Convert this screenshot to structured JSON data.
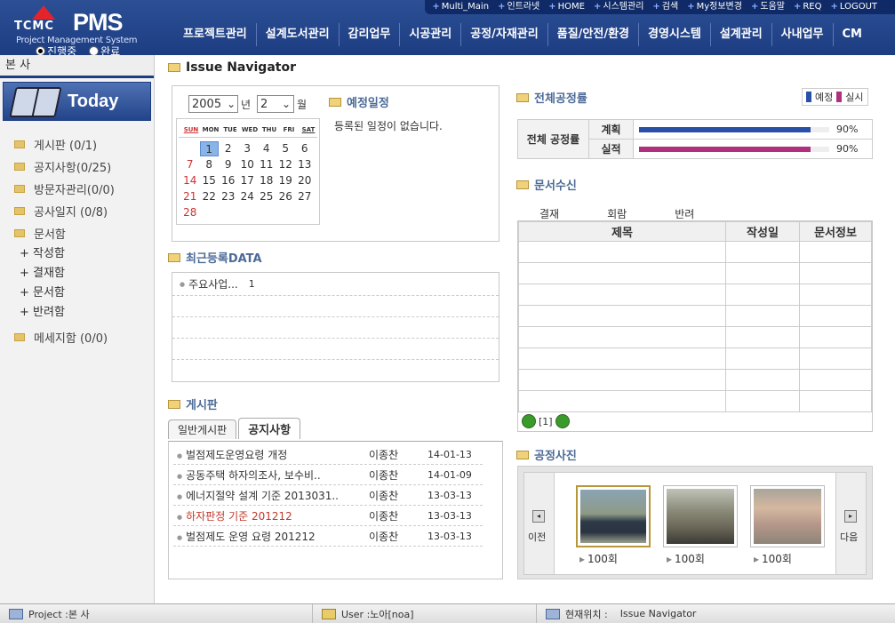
{
  "toplinks": [
    "Multi_Main",
    "인트라넷",
    "HOME",
    "시스템관리",
    "검색",
    "My정보변경",
    "도움말",
    "REQ",
    "LOGOUT"
  ],
  "logo": {
    "brand": "TCMC",
    "product": "PMS",
    "subtitle": "Project Management System"
  },
  "status_radios": [
    {
      "label": "진행중",
      "checked": true
    },
    {
      "label": "완료",
      "checked": false
    }
  ],
  "nav": [
    "프로젝트관리",
    "설계도서관리",
    "감리업무",
    "시공관리",
    "공정/자재관리",
    "품질/안전/환경",
    "경영시스템",
    "설계관리",
    "사내업무",
    "CM"
  ],
  "sidebar": {
    "site": "본 사",
    "today_label": "Today",
    "items": [
      "게시판 (0/1)",
      "공지사항(0/25)",
      "방문자관리(0/0)",
      "공사일지 (0/8)",
      "문서함"
    ],
    "sub_items": [
      "+ 작성함",
      "+ 결재함",
      "+ 문서함",
      "+ 반려함"
    ],
    "last_item": "메세지함 (0/0)"
  },
  "page_title": "Issue Navigator",
  "calendar": {
    "year": "2005",
    "year_suffix": "년",
    "month": "2",
    "month_suffix": "월",
    "weekdays": [
      "SUN",
      "MON",
      "TUE",
      "WED",
      "THU",
      "FRI",
      "SAT"
    ],
    "days": [
      "",
      "1",
      "2",
      "3",
      "4",
      "5",
      "6",
      "7",
      "8",
      "9",
      "10",
      "11",
      "12",
      "13",
      "14",
      "15",
      "16",
      "17",
      "18",
      "19",
      "20",
      "21",
      "22",
      "23",
      "24",
      "25",
      "26",
      "27",
      "28"
    ]
  },
  "schedule": {
    "title": "예정일정",
    "empty": "등록된 일정이 없습니다."
  },
  "recent": {
    "title": "최근등록DATA",
    "item": "주요사업...",
    "count": "1"
  },
  "board": {
    "title": "게시판",
    "tabs": [
      "일반게시판",
      "공지사항"
    ],
    "rows": [
      {
        "title": "벌점제도운영요령 개정",
        "writer": "이종찬",
        "date": "14-01-13",
        "hl": false
      },
      {
        "title": "공동주택 하자의조사, 보수비..",
        "writer": "이종찬",
        "date": "14-01-09",
        "hl": false
      },
      {
        "title": "에너지절약 설계 기준 2013031..",
        "writer": "이종찬",
        "date": "13-03-13",
        "hl": false
      },
      {
        "title": "하자판정 기준 201212",
        "writer": "이종찬",
        "date": "13-03-13",
        "hl": true
      },
      {
        "title": "벌점제도 운영 요령 201212",
        "writer": "이종찬",
        "date": "13-03-13",
        "hl": false
      }
    ]
  },
  "progress": {
    "title": "전체공정률",
    "legend": [
      "예정",
      "실시"
    ],
    "row_label": "전체 공정률",
    "items": [
      {
        "label": "계획",
        "value": 90,
        "text": "90%",
        "color": "#2a4fa8"
      },
      {
        "label": "실적",
        "value": 90,
        "text": "90%",
        "color": "#b0307e"
      }
    ]
  },
  "docs": {
    "title": "문서수신",
    "tabs": [
      "결재",
      "회람",
      "반려"
    ],
    "cols": [
      "제목",
      "작성일",
      "문서정보"
    ],
    "pager": "[1]"
  },
  "photos": {
    "title": "공정사진",
    "prev": "이전",
    "next": "다음",
    "items": [
      "100회",
      "100회",
      "100회"
    ]
  },
  "footer": {
    "project": "Project :본 사",
    "user": "User :노아[noa]",
    "location_label": "현재위치 :",
    "location": "Issue Navigator"
  }
}
